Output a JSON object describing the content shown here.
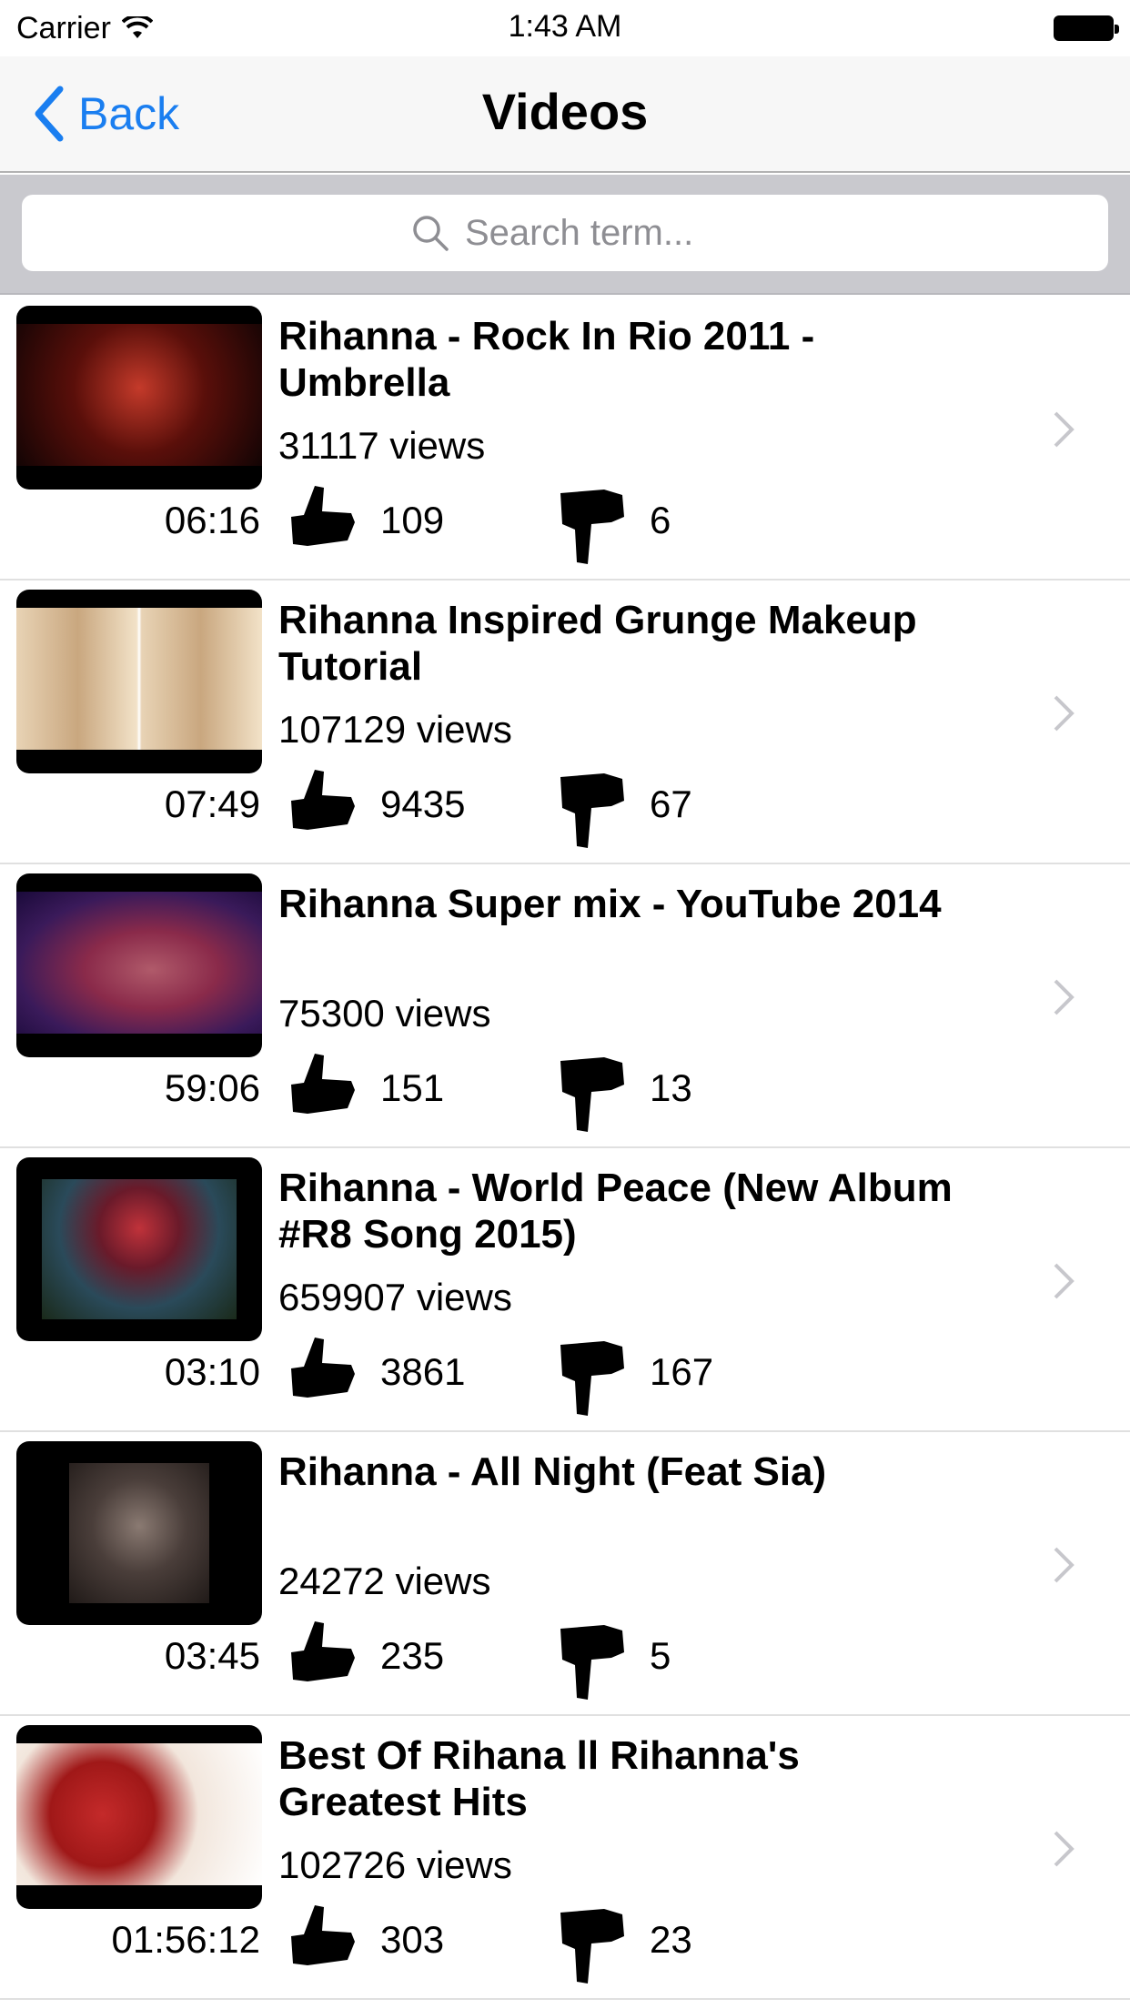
{
  "status_bar": {
    "carrier": "Carrier",
    "time": "1:43 AM"
  },
  "nav": {
    "back_label": "Back",
    "title": "Videos"
  },
  "search": {
    "placeholder": "Search term..."
  },
  "videos": [
    {
      "title": "Rihanna - Rock In Rio 2011 - Umbrella",
      "views": "31117 views",
      "likes": "109",
      "dislikes": "6",
      "duration": "06:16"
    },
    {
      "title": "Rihanna Inspired Grunge Makeup Tutorial",
      "views": "107129 views",
      "likes": "9435",
      "dislikes": "67",
      "duration": "07:49"
    },
    {
      "title": "Rihanna Super mix - YouTube 2014",
      "views": "75300 views",
      "likes": "151",
      "dislikes": "13",
      "duration": "59:06"
    },
    {
      "title": "Rihanna - World Peace (New Album #R8 Song 2015)",
      "views": "659907 views",
      "likes": "3861",
      "dislikes": "167",
      "duration": "03:10"
    },
    {
      "title": "Rihanna - All Night (Feat Sia)",
      "views": "24272 views",
      "likes": "235",
      "dislikes": "5",
      "duration": "03:45"
    },
    {
      "title": "Best Of Rihana ll Rihanna's Greatest Hits",
      "views": "102726 views",
      "likes": "303",
      "dislikes": "23",
      "duration": "01:56:12"
    }
  ],
  "colors": {
    "accent": "#1a7ef0",
    "search_bg": "#c9c9ce",
    "nav_bg": "#f7f7f7"
  }
}
